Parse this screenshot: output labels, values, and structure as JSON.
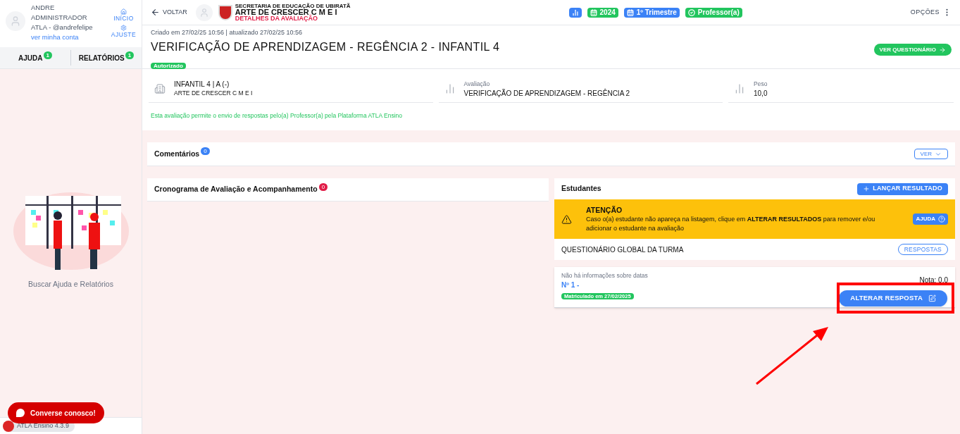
{
  "user": {
    "name_lines": [
      "ANDRE",
      "ADMINISTRADOR",
      "ATLA - @andrefelipe"
    ],
    "account_link": "ver minha conta"
  },
  "quick_links": [
    {
      "label": "INÍCIO",
      "kind": "home"
    },
    {
      "label": "AJUSTE",
      "kind": "settings"
    }
  ],
  "sidebar_tabs": [
    {
      "label": "AJUDA",
      "count": "1"
    },
    {
      "label": "RELATÓRIOS",
      "count": "1"
    }
  ],
  "sidebar_caption": "Buscar Ajuda e Relatórios",
  "chat_button": "Converse conosco!",
  "version": "ATLA Ensino 4.3.9",
  "topbar": {
    "back": "VOLTAR",
    "org": "SECRETARIA DE EDUCAÇÃO DE UBIRATÃ",
    "school": "ARTE DE CRESCER C M E I",
    "page": "DETALHES DA AVALIAÇÃO",
    "options": "OPÇÕES"
  },
  "chips": [
    {
      "kind": "chart",
      "color": "#3b82f6"
    },
    {
      "kind": "calendar",
      "label": "2024",
      "color": "#22c55e"
    },
    {
      "kind": "calendar",
      "label": "1º Trimestre",
      "color": "#3b82f6"
    },
    {
      "kind": "check",
      "label": "Professor(a)",
      "color": "#22c55e"
    }
  ],
  "header": {
    "meta": "Criado em 27/02/25 10:56 | atualizado 27/02/25 10:56",
    "title": "VERIFICAÇÃO DE APRENDIZAGEM - REGÊNCIA 2 - INFANTIL 4",
    "status": "Autorizado",
    "action": "VER QUESTIONÁRIO"
  },
  "info": [
    {
      "kind": "building",
      "label": "INFANTIL 4 | A (-)",
      "value": "ARTE DE CRESCER C M E I"
    },
    {
      "kind": "chart",
      "label": "Avaliação",
      "value": "VERIFICAÇÃO DE APRENDIZAGEM - REGÊNCIA 2"
    },
    {
      "kind": "chart",
      "label": "Peso",
      "value": "10,0"
    }
  ],
  "notice": "Esta avaliação permite o envio de respostas pelo(a) Professor(a) pela Plataforma ATLA Ensino",
  "comments": {
    "title": "Comentários",
    "count": "0",
    "button": "VER"
  },
  "schedule": {
    "title": "Cronograma de Avaliação e Acompanhamento",
    "count": "0"
  },
  "students": {
    "title": "Estudantes",
    "button": "LANÇAR RESULTADO",
    "alert": {
      "title": "ATENÇÃO",
      "text": "Caso o(a) estudante não apareça na listagem, clique em **ALTERAR RESULTADOS** para remover e/ou adicionar o estudante na avaliação",
      "button": "AJUDA"
    },
    "global": {
      "label": "QUESTIONÁRIO GLOBAL DA TURMA",
      "button": "RESPOSTAS"
    },
    "rows": [
      {
        "dates": "Não há informações sobre datas",
        "number": "Nº 1 -",
        "badge": "Matriculado em 27/02/2025",
        "grade": "Nota: 0,0",
        "button": "ALTERAR RESPOSTA"
      }
    ]
  }
}
